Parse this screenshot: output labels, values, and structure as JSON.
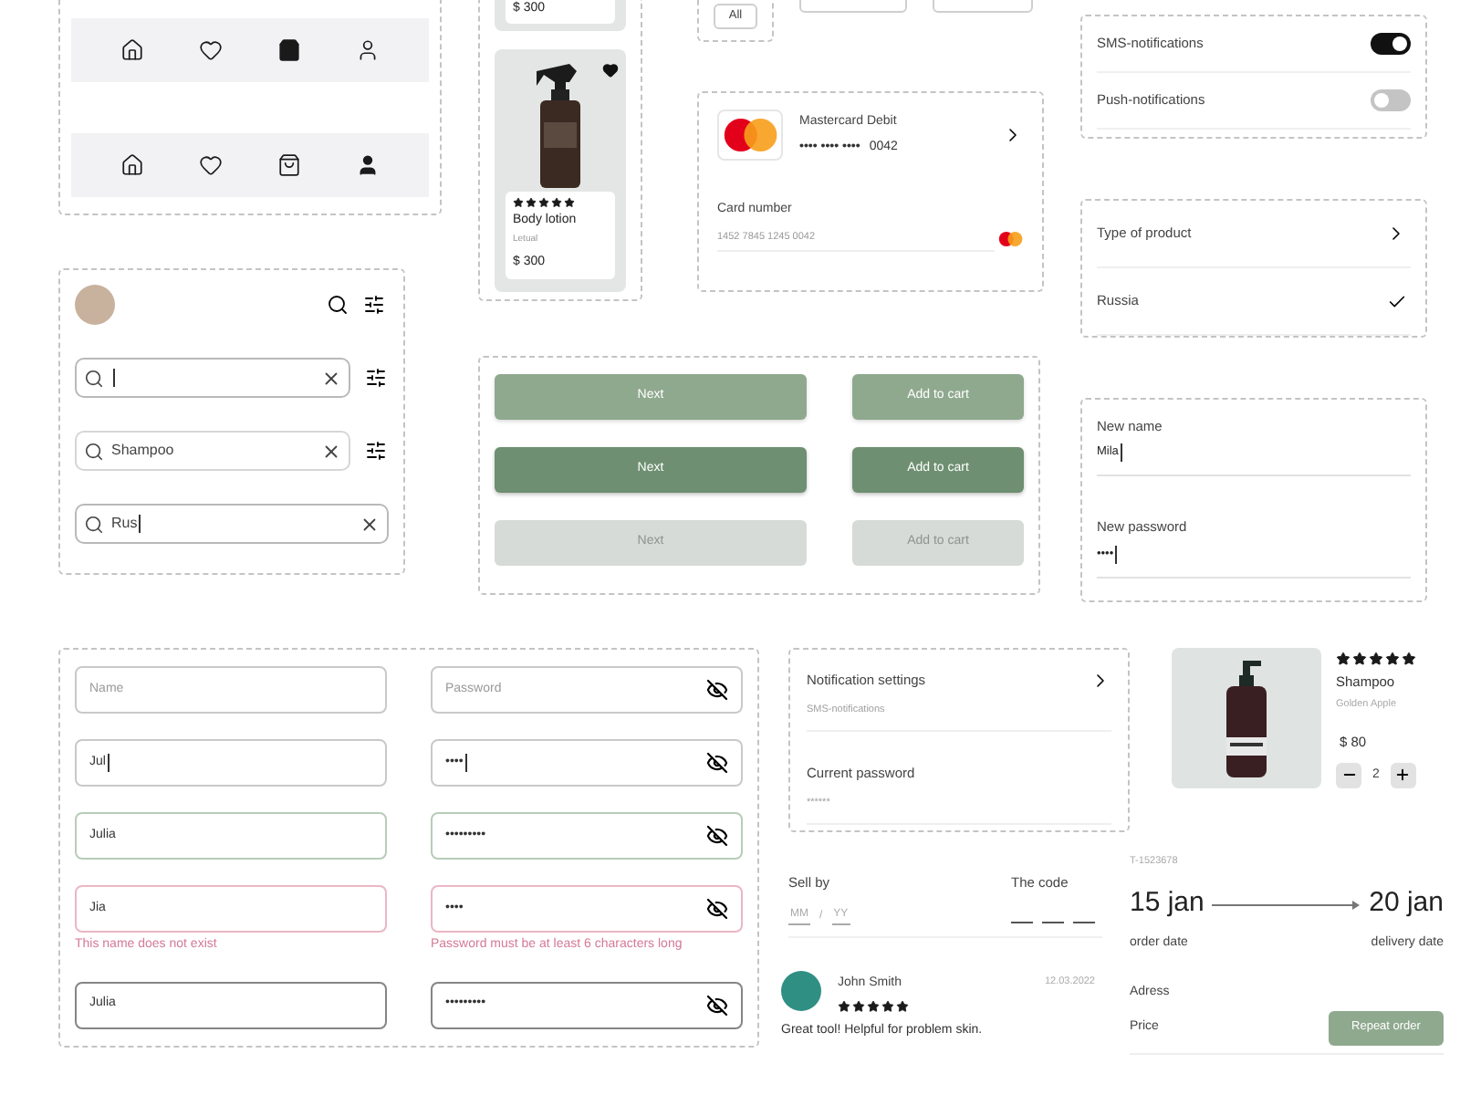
{
  "nav_bars": [
    {
      "items": [
        {
          "kind": "home",
          "selected": false
        },
        {
          "kind": "heart",
          "selected": false
        },
        {
          "kind": "bag",
          "selected": true
        },
        {
          "kind": "user",
          "selected": false
        }
      ]
    },
    {
      "items": [
        {
          "kind": "home",
          "selected": false
        },
        {
          "kind": "heart",
          "selected": false
        },
        {
          "kind": "bag",
          "selected": false
        },
        {
          "kind": "user",
          "selected": true
        }
      ]
    }
  ],
  "search_fields": [
    {
      "focused": true,
      "filter": true
    },
    {
      "value": "Shampoo",
      "focused": false,
      "filter": true
    },
    {
      "value": "Rus",
      "focused": true,
      "filter": false
    }
  ],
  "product_cards": [
    {
      "kind": "partial",
      "price": "$ 300"
    },
    {
      "kind": "full",
      "stars": 5,
      "name": "Body lotion",
      "brand": "Letual",
      "price": "$ 300",
      "favorite": true
    }
  ],
  "filter_chips": [
    "All"
  ],
  "payment_card": {
    "title": "Mastercard Debit",
    "masked": "•••• •••• ••••",
    "last4": "0042"
  },
  "card_number": {
    "label": "Card number",
    "value": "1452 7845 1245 0042"
  },
  "button_rows": [
    {
      "kind": "default",
      "buttons": [
        "Next",
        "Add to cart"
      ]
    },
    {
      "kind": "pressed",
      "buttons": [
        "Next",
        "Add to cart"
      ]
    },
    {
      "kind": "disabled",
      "buttons": [
        "Next",
        "Add to cart"
      ]
    }
  ],
  "toggles": [
    {
      "label": "SMS-notifications",
      "on": true
    },
    {
      "label": "Push-notifications",
      "on": false
    }
  ],
  "options": [
    {
      "label": "Type of product",
      "kind": "link"
    },
    {
      "label": "Russia",
      "kind": "checked"
    }
  ],
  "profile_fields": [
    {
      "label": "New name",
      "value": "Mila",
      "focused": true
    },
    {
      "label": "New password",
      "value": "••••",
      "focused": true
    }
  ],
  "form_rows": [
    {
      "name": {
        "placeholder": "Name",
        "kind": "default",
        "focused": false
      },
      "password": {
        "placeholder": "Password",
        "kind": "default",
        "focused": false
      }
    },
    {
      "name": {
        "value": "Jul",
        "kind": "default",
        "focused": true
      },
      "password": {
        "value": "••••",
        "kind": "default",
        "focused": true
      }
    },
    {
      "name": {
        "value": "Julia",
        "kind": "success",
        "focused": false
      },
      "password": {
        "value": "•••••••••",
        "kind": "success",
        "focused": false
      }
    },
    {
      "name": {
        "value": "Jia",
        "kind": "error",
        "focused": false,
        "error": "This name does not exist"
      },
      "password": {
        "value": "••••",
        "kind": "error",
        "focused": false,
        "error": "Password must be at least 6 characters long"
      }
    },
    {
      "name": {
        "value": "Julia",
        "kind": "filled",
        "focused": false
      },
      "password": {
        "value": "•••••••••",
        "kind": "filled",
        "focused": false
      }
    }
  ],
  "settings_list": [
    {
      "title": "Notification settings",
      "subtitle": "SMS-notifications",
      "kind": "link"
    },
    {
      "title": "Current password",
      "subtitle": "******",
      "kind": "plain"
    }
  ],
  "expiry": {
    "label": "Sell by",
    "month_placeholder": "MM",
    "separator": "/",
    "year_placeholder": "YY"
  },
  "code": {
    "label": "The code"
  },
  "review": {
    "author": "John Smith",
    "stars": 5,
    "date": "12.03.2022",
    "text": "Great tool! Helpful for problem skin."
  },
  "cart_item": {
    "stars": 5,
    "name": "Shampoo",
    "brand": "Golden Apple",
    "price": "$ 80",
    "quantity": "2"
  },
  "order": {
    "number": "T-1523678",
    "order_date": "15 jan",
    "order_date_label": "order date",
    "delivery_date": "20 jan",
    "delivery_date_label": "delivery date",
    "rows": [
      "Adress",
      "Price"
    ],
    "button": "Repeat order"
  }
}
